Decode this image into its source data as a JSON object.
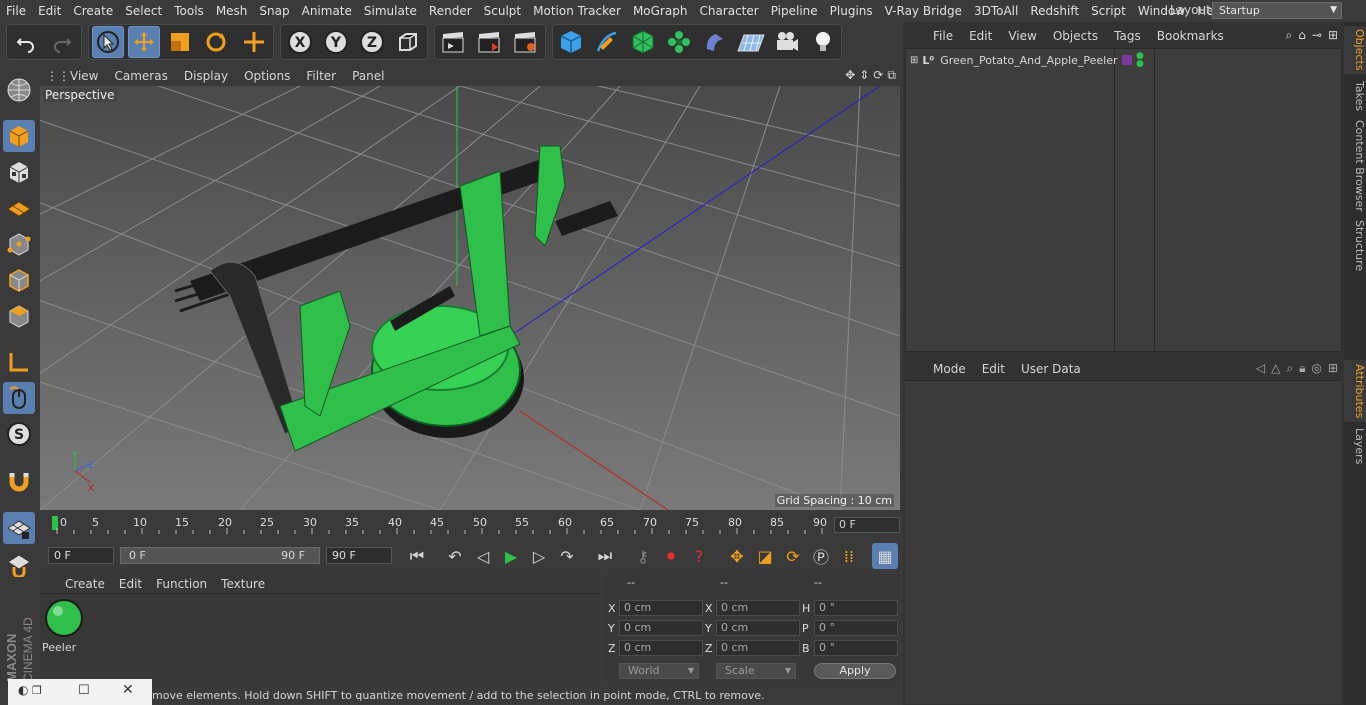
{
  "menubar": {
    "items": [
      "File",
      "Edit",
      "Create",
      "Select",
      "Tools",
      "Mesh",
      "Snap",
      "Animate",
      "Simulate",
      "Render",
      "Sculpt",
      "Motion Tracker",
      "MoGraph",
      "Character",
      "Pipeline",
      "Plugins",
      "V-Ray Bridge",
      "3DToAll",
      "Redshift",
      "Script",
      "Window",
      "Help"
    ],
    "layout_label": "Layout:",
    "layout_value": "Startup"
  },
  "viewport": {
    "menu": [
      "View",
      "Cameras",
      "Display",
      "Options",
      "Filter",
      "Panel"
    ],
    "camera_label": "Perspective",
    "grid_spacing": "Grid Spacing : 10 cm"
  },
  "timeline": {
    "ticks": [
      "0",
      "5",
      "10",
      "15",
      "20",
      "25",
      "30",
      "35",
      "40",
      "45",
      "50",
      "55",
      "60",
      "65",
      "70",
      "75",
      "80",
      "85",
      "90"
    ],
    "current_frame": "0 F"
  },
  "transport": {
    "start_field": "0 F",
    "range_start": "0 F",
    "range_end": "90 F",
    "end_field": "90 F"
  },
  "material_manager": {
    "menu": [
      "Create",
      "Edit",
      "Function",
      "Texture"
    ],
    "material_name": "Peeler"
  },
  "coordinates": {
    "headers": [
      "--",
      "--",
      "--"
    ],
    "rows": [
      {
        "a": "X",
        "av": "0 cm",
        "b": "X",
        "bv": "0 cm",
        "c": "H",
        "cv": "0 °"
      },
      {
        "a": "Y",
        "av": "0 cm",
        "b": "Y",
        "bv": "0 cm",
        "c": "P",
        "cv": "0 °"
      },
      {
        "a": "Z",
        "av": "0 cm",
        "b": "Z",
        "bv": "0 cm",
        "c": "B",
        "cv": "0 °"
      }
    ],
    "world_select": "World",
    "scale_select": "Scale",
    "apply_label": "Apply"
  },
  "status": {
    "text": "move elements. Hold down SHIFT to quantize movement / add to the selection in point mode, CTRL to remove."
  },
  "objects": {
    "menu": [
      "File",
      "Edit",
      "View",
      "Objects",
      "Tags",
      "Bookmarks"
    ],
    "items": [
      {
        "name": "Green_Potato_And_Apple_Peeler"
      }
    ]
  },
  "attributes": {
    "menu": [
      "Mode",
      "Edit",
      "User Data"
    ]
  },
  "side_tabs": [
    "Objects",
    "Takes",
    "Content Browser",
    "Structure",
    "Attributes",
    "Layers"
  ],
  "branding": {
    "maxon": "MAXON",
    "product": "CINEMA 4D"
  },
  "colors": {
    "accent": "#5a7fb0",
    "peeler_green": "#2fbf4a",
    "active_tab": "#f0a030"
  }
}
